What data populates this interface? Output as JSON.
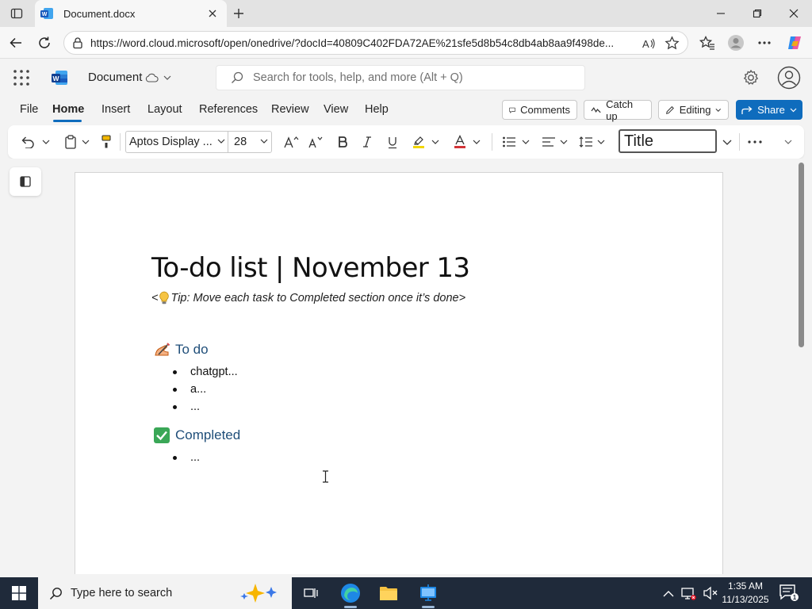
{
  "browser": {
    "tab_title": "Document.docx",
    "url": "https://word.cloud.microsoft/open/onedrive/?docId=40809C402FDA72AE%21sfe5d8b54c8db4ab8aa9f498de..."
  },
  "word": {
    "doc_name": "Document",
    "search_placeholder": "Search for tools, help, and more (Alt + Q)",
    "ribbon_tabs": [
      "File",
      "Home",
      "Insert",
      "Layout",
      "References",
      "Review",
      "View",
      "Help"
    ],
    "active_tab": "Home",
    "comments_label": "Comments",
    "catchup_label": "Catch up",
    "editing_label": "Editing",
    "share_label": "Share",
    "font_name": "Aptos Display ...",
    "font_size": "28",
    "style_name": "Title",
    "accent_color": "#0f6cbd"
  },
  "document": {
    "title": "To-do list | November 13",
    "tip_prefix": "<",
    "tip_text": "Tip: Move each task to Completed section once it’s done>",
    "todo_heading": "To do",
    "todo_items": [
      "chatgpt...",
      "a...",
      "..."
    ],
    "completed_heading": "Completed",
    "completed_items": [
      "..."
    ]
  },
  "taskbar": {
    "search_text": "Type here to search",
    "time": "1:35 AM",
    "date": "11/13/2025"
  }
}
